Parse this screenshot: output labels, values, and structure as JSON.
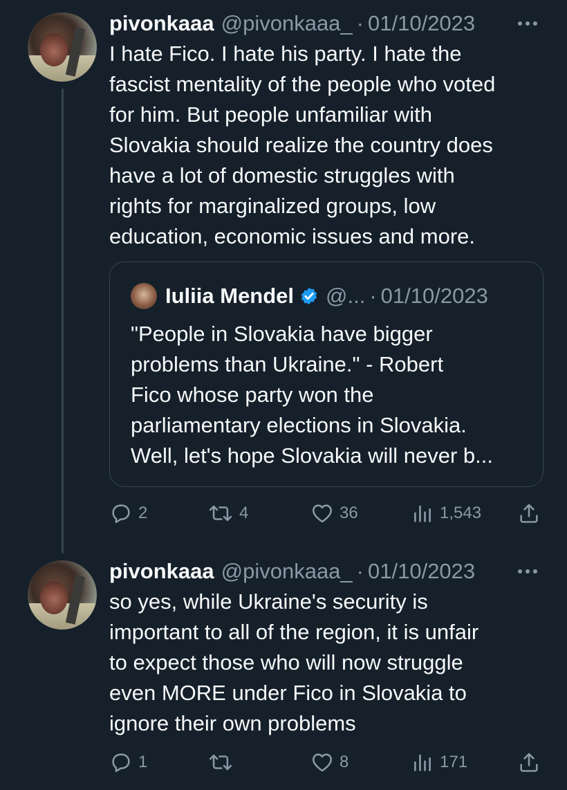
{
  "tweets": [
    {
      "display_name": "pivonkaaa",
      "handle": "@pivonkaaa_",
      "date": "01/10/2023",
      "text": "I hate Fico. I hate his party. I hate the\nfascist mentality of the people who voted\nfor him. But people unfamiliar with\nSlovakia should realize the country does\nhave a lot of domestic struggles with\nrights for marginalized groups, low\neducation, economic issues and more.",
      "quote": {
        "display_name": "Iuliia Mendel",
        "handle": "@...",
        "date": "01/10/2023",
        "text": "\"People in Slovakia have bigger\nproblems than Ukraine.\" - Robert\nFico whose party won the\nparliamentary elections in Slovakia.\nWell, let's hope Slovakia will never b..."
      },
      "stats": {
        "replies": "2",
        "retweets": "4",
        "likes": "36",
        "views": "1,543"
      }
    },
    {
      "display_name": "pivonkaaa",
      "handle": "@pivonkaaa_",
      "date": "01/10/2023",
      "text": "so yes, while Ukraine's security is\nimportant to all of the region, it is unfair\nto expect those who will now struggle\neven MORE under Fico in Slovakia to\nignore their own problems",
      "stats": {
        "replies": "1",
        "retweets": "",
        "likes": "8",
        "views": "171"
      }
    }
  ],
  "separator": "·",
  "icons": [
    "avatar",
    "more-icon",
    "verified-badge-icon",
    "reply-icon",
    "retweet-icon",
    "like-icon",
    "views-icon",
    "share-icon"
  ],
  "colors": {
    "background": "#15202b",
    "text": "#f7f9f9",
    "secondary_text": "#8b98a5",
    "border": "#38444d",
    "verified": "#1d9bf0"
  }
}
